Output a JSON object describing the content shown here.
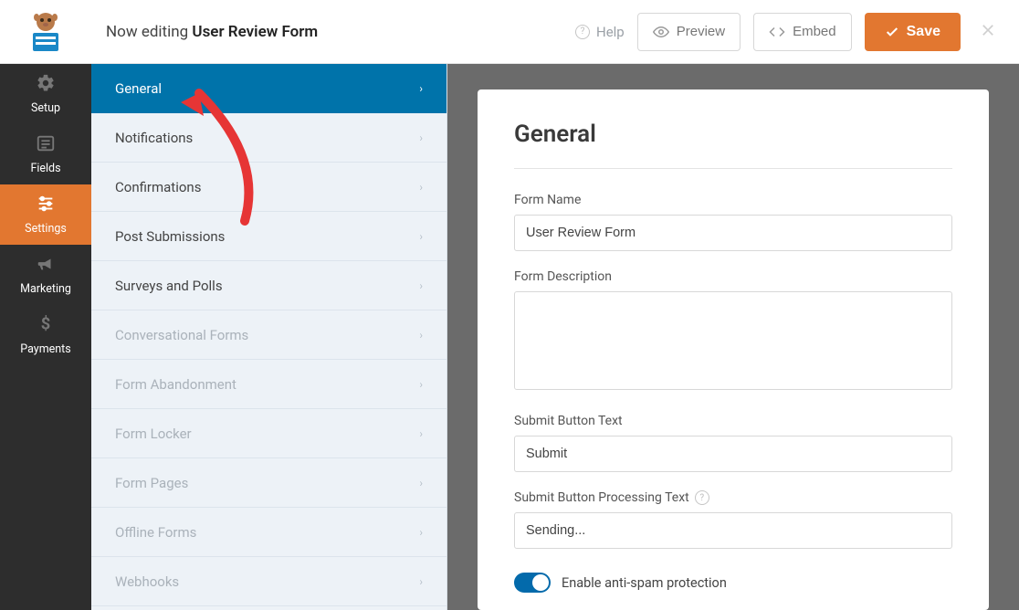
{
  "topbar": {
    "title_prefix": "Now editing",
    "title_bold": "User Review Form",
    "help": "Help",
    "preview": "Preview",
    "embed": "Embed",
    "save": "Save"
  },
  "sidebar": {
    "items": [
      {
        "label": "Setup",
        "icon": "gear"
      },
      {
        "label": "Fields",
        "icon": "list"
      },
      {
        "label": "Settings",
        "icon": "sliders",
        "active": true
      },
      {
        "label": "Marketing",
        "icon": "bullhorn"
      },
      {
        "label": "Payments",
        "icon": "dollar"
      }
    ]
  },
  "submenu": {
    "items": [
      {
        "label": "General",
        "active": true
      },
      {
        "label": "Notifications"
      },
      {
        "label": "Confirmations"
      },
      {
        "label": "Post Submissions"
      },
      {
        "label": "Surveys and Polls"
      },
      {
        "label": "Conversational Forms",
        "disabled": true
      },
      {
        "label": "Form Abandonment",
        "disabled": true
      },
      {
        "label": "Form Locker",
        "disabled": true
      },
      {
        "label": "Form Pages",
        "disabled": true
      },
      {
        "label": "Offline Forms",
        "disabled": true
      },
      {
        "label": "Webhooks",
        "disabled": true
      }
    ]
  },
  "panel": {
    "heading": "General",
    "form_name_label": "Form Name",
    "form_name_value": "User Review Form",
    "form_description_label": "Form Description",
    "form_description_value": "",
    "submit_text_label": "Submit Button Text",
    "submit_text_value": "Submit",
    "submit_processing_label": "Submit Button Processing Text",
    "submit_processing_value": "Sending...",
    "antispam_label": "Enable anti-spam protection"
  }
}
